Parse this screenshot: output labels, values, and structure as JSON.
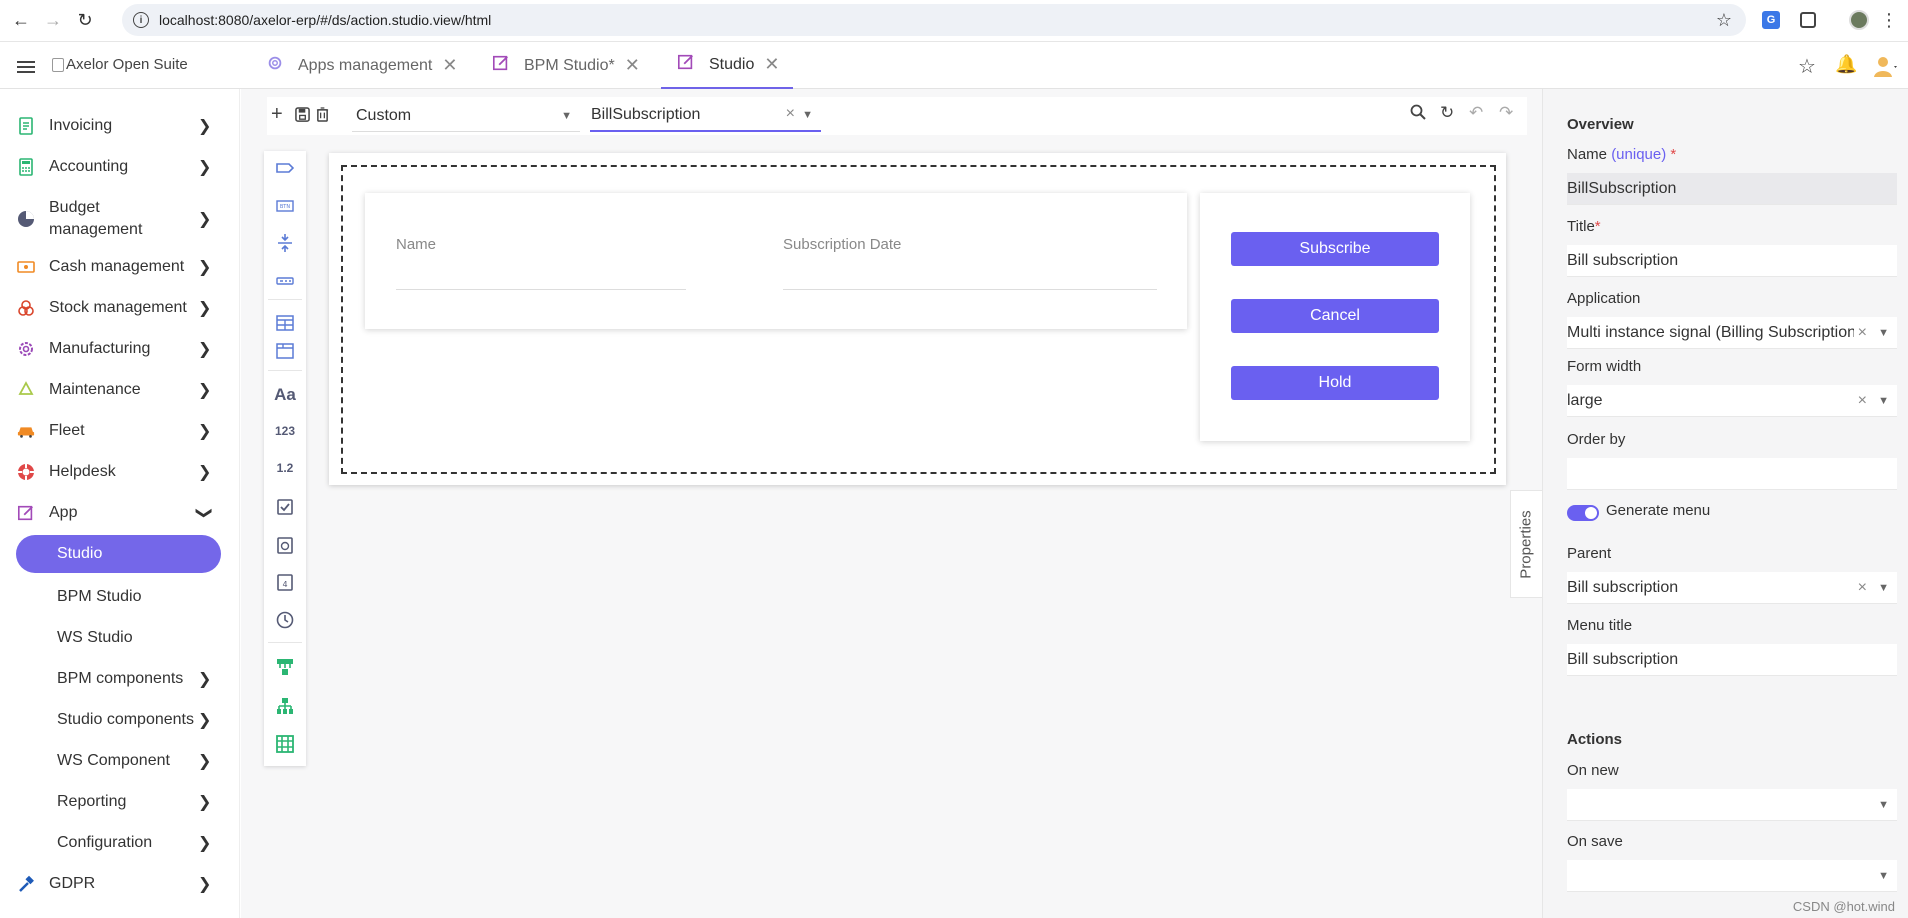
{
  "browser": {
    "url": "localhost:8080/axelor-erp/#/ds/action.studio.view/html"
  },
  "header": {
    "logo_alt": "Axelor Open Suite",
    "tabs": [
      {
        "label": "Apps management"
      },
      {
        "label": "BPM Studio*"
      },
      {
        "label": "Studio"
      }
    ]
  },
  "sidebar": {
    "items": [
      {
        "label": "Invoicing",
        "icon": "invoice-icon"
      },
      {
        "label": "Accounting",
        "icon": "calculator-icon"
      },
      {
        "label": "Budget management",
        "icon": "pie-chart-icon"
      },
      {
        "label": "Cash management",
        "icon": "cash-icon"
      },
      {
        "label": "Stock management",
        "icon": "boxes-icon"
      },
      {
        "label": "Manufacturing",
        "icon": "cog-icon"
      },
      {
        "label": "Maintenance",
        "icon": "recycle-icon"
      },
      {
        "label": "Fleet",
        "icon": "car-icon"
      },
      {
        "label": "Helpdesk",
        "icon": "lifebuoy-icon"
      },
      {
        "label": "App",
        "icon": "edit-icon"
      }
    ],
    "sub_items": [
      {
        "label": "Studio"
      },
      {
        "label": "BPM Studio"
      },
      {
        "label": "WS Studio"
      },
      {
        "label": "BPM components"
      },
      {
        "label": "Studio components"
      },
      {
        "label": "WS Component"
      },
      {
        "label": "Reporting"
      },
      {
        "label": "Configuration"
      }
    ],
    "last_item": {
      "label": "GDPR",
      "icon": "hammer-icon"
    }
  },
  "toolbar": {
    "type_select": "Custom",
    "view_select": "BillSubscription"
  },
  "canvas": {
    "fields": [
      {
        "label": "Name"
      },
      {
        "label": "Subscription Date"
      }
    ],
    "buttons": [
      {
        "label": "Subscribe"
      },
      {
        "label": "Cancel"
      },
      {
        "label": "Hold"
      }
    ]
  },
  "properties_tab": "Properties",
  "properties": {
    "overview_heading": "Overview",
    "name_label": "Name",
    "name_unique": "(unique)",
    "required_mark": "*",
    "name_value": "BillSubscription",
    "title_label": "Title",
    "title_value": "Bill subscription",
    "application_label": "Application",
    "application_value": "Multi instance signal (Billing Subscription)",
    "form_width_label": "Form width",
    "form_width_value": "large",
    "order_by_label": "Order by",
    "order_by_value": "",
    "generate_menu_label": "Generate menu",
    "generate_menu_on": true,
    "parent_label": "Parent",
    "parent_value": "Bill subscription",
    "menu_title_label": "Menu title",
    "menu_title_value": "Bill subscription",
    "actions_heading": "Actions",
    "on_new_label": "On new",
    "on_save_label": "On save"
  },
  "watermark": "CSDN @hot.wind",
  "colors": {
    "accent": "#6a60f0",
    "sidebar_active": "#7467e9",
    "palette_icon": "#5b7bd6",
    "palette_green": "#2bb673"
  }
}
